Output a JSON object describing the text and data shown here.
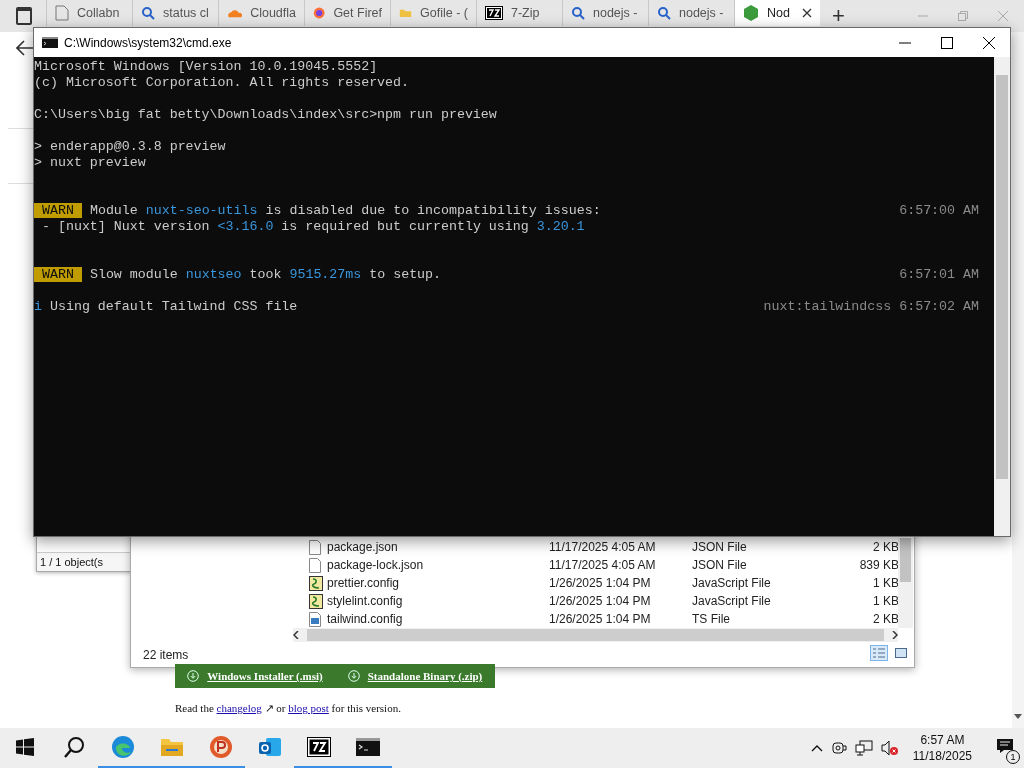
{
  "browser": {
    "tabs": [
      {
        "kind": "page",
        "label": "Collabn",
        "selected": false
      },
      {
        "kind": "search",
        "label": "status cl",
        "selected": false
      },
      {
        "kind": "cloud",
        "label": "Cloudfla",
        "selected": false
      },
      {
        "kind": "fox",
        "label": "Get Firef",
        "selected": false
      },
      {
        "kind": "folder",
        "label": "Gofile - (",
        "selected": false
      },
      {
        "kind": "zip",
        "label": "7-Zip",
        "selected": false
      },
      {
        "kind": "search",
        "label": "nodejs -",
        "selected": false
      },
      {
        "kind": "search",
        "label": "nodejs -",
        "selected": false
      },
      {
        "kind": "hex",
        "label": "Nod",
        "selected": true
      }
    ],
    "new_tab": "+"
  },
  "page": {
    "download_buttons": [
      "Windows Installer (.msi)",
      "Standalone Binary (.zip)"
    ],
    "note": [
      {
        "kind": "text",
        "text": "Read the "
      },
      {
        "kind": "link",
        "text": "changelog"
      },
      {
        "kind": "text",
        "text": " ↗ or "
      },
      {
        "kind": "link",
        "text": "blog post"
      },
      {
        "kind": "text",
        "text": " for this version."
      }
    ]
  },
  "side_window": {
    "status": "1 / 1 object(s"
  },
  "explorer": {
    "files": [
      {
        "kind": "doc",
        "name": "package.json",
        "date": "11/17/2025 4:05 AM",
        "type": "JSON File",
        "size": "2 KB"
      },
      {
        "kind": "doc",
        "name": "package-lock.json",
        "date": "11/17/2025 4:05 AM",
        "type": "JSON File",
        "size": "839 KB"
      },
      {
        "kind": "script",
        "name": "prettier.config",
        "date": "1/26/2025 1:04 PM",
        "type": "JavaScript File",
        "size": "1 KB"
      },
      {
        "kind": "script",
        "name": "stylelint.config",
        "date": "1/26/2025 1:04 PM",
        "type": "JavaScript File",
        "size": "1 KB"
      },
      {
        "kind": "ts",
        "name": "tailwind.config",
        "date": "1/26/2025 1:04 PM",
        "type": "TS File",
        "size": "2 KB"
      }
    ],
    "status": "22 items",
    "views": [
      {
        "kind": "details",
        "selected": true
      },
      {
        "kind": "tiles",
        "selected": false
      }
    ]
  },
  "console": {
    "title": "C:\\Windows\\system32\\cmd.exe",
    "lines": [
      {
        "kind": "line",
        "segments": [
          {
            "kind": "plain",
            "text": "Microsoft Windows [Version 10.0.19045.5552]"
          }
        ]
      },
      {
        "kind": "line",
        "segments": [
          {
            "kind": "plain",
            "text": "(c) Microsoft Corporation. All rights reserved."
          }
        ]
      },
      {
        "kind": "blank"
      },
      {
        "kind": "line",
        "segments": [
          {
            "kind": "plain",
            "text": "C:\\Users\\big fat betty\\Downloads\\index\\src>npm run preview"
          }
        ]
      },
      {
        "kind": "blank"
      },
      {
        "kind": "line",
        "segments": [
          {
            "kind": "plain",
            "text": "> enderapp@0.3.8 preview"
          }
        ]
      },
      {
        "kind": "line",
        "segments": [
          {
            "kind": "plain",
            "text": "> nuxt preview"
          }
        ]
      },
      {
        "kind": "blank"
      },
      {
        "kind": "blank"
      },
      {
        "kind": "line",
        "segments": [
          {
            "kind": "badge",
            "text": "WARN"
          },
          {
            "kind": "plain",
            "text": "Module "
          },
          {
            "kind": "link",
            "text": "nuxt-seo-utils"
          },
          {
            "kind": "plain",
            "text": " is disabled due to incompatibility issues:"
          }
        ],
        "right": "6:57:00 AM"
      },
      {
        "kind": "line",
        "segments": [
          {
            "kind": "plain",
            "text": " - [nuxt] Nuxt version "
          },
          {
            "kind": "link",
            "text": "<3.16.0"
          },
          {
            "kind": "plain",
            "text": " is required but currently using "
          },
          {
            "kind": "link",
            "text": "3.20.1"
          }
        ]
      },
      {
        "kind": "blank"
      },
      {
        "kind": "blank"
      },
      {
        "kind": "line",
        "segments": [
          {
            "kind": "badge",
            "text": "WARN"
          },
          {
            "kind": "plain",
            "text": "Slow module "
          },
          {
            "kind": "link",
            "text": "nuxtseo"
          },
          {
            "kind": "plain",
            "text": " took "
          },
          {
            "kind": "link",
            "text": "9515.27ms"
          },
          {
            "kind": "plain",
            "text": " to setup."
          }
        ],
        "right": "6:57:01 AM"
      },
      {
        "kind": "blank"
      },
      {
        "kind": "line",
        "segments": [
          {
            "kind": "link",
            "text": "i"
          },
          {
            "kind": "plain",
            "text": " Using default Tailwind CSS file"
          }
        ],
        "right": "nuxt:tailwindcss 6:57:02 AM"
      }
    ]
  },
  "taskbar": {
    "apps": [
      {
        "kind": "start",
        "running": false
      },
      {
        "kind": "search",
        "running": false
      },
      {
        "kind": "edge",
        "running": true
      },
      {
        "kind": "files",
        "running": true
      },
      {
        "kind": "paint",
        "running": true
      },
      {
        "kind": "mail",
        "running": false
      },
      {
        "kind": "zip",
        "running": true
      },
      {
        "kind": "terminal",
        "running": true
      }
    ],
    "time": "6:57 AM",
    "date": "11/18/2025",
    "notifications": "1"
  }
}
